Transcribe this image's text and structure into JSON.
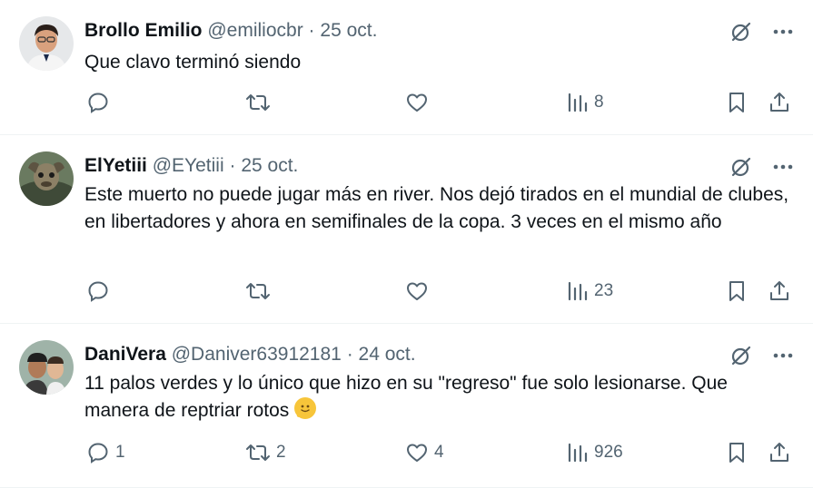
{
  "tweets": [
    {
      "name": "Brollo Emilio",
      "handle": "@emiliocbr",
      "separator": "·",
      "date": "25 oct.",
      "text": "Que clavo terminó siendo",
      "replies": "",
      "retweets": "",
      "likes": "",
      "views": "8"
    },
    {
      "name": "ElYetiii",
      "handle": "@EYetiii",
      "separator": "·",
      "date": "25 oct.",
      "text": "Este muerto no puede jugar más en river. Nos dejó tirados en el mundial de clubes, en libertadores y ahora en semifinales de la copa. 3 veces en el mismo año",
      "replies": "",
      "retweets": "",
      "likes": "",
      "views": "23"
    },
    {
      "name": "DaniVera",
      "handle": "@Daniver63912181",
      "separator": "·",
      "date": "24 oct.",
      "text": "11 palos verdes y lo único que hizo en su \"regreso\" fue solo lesionarse. Que manera de reptriar rotos",
      "emoji": "melting-face-emoji",
      "replies": "1",
      "retweets": "2",
      "likes": "4",
      "views": "926"
    }
  ],
  "colors": {
    "text": "#0f1419",
    "secondary": "#536471",
    "divider": "#eff3f4"
  }
}
